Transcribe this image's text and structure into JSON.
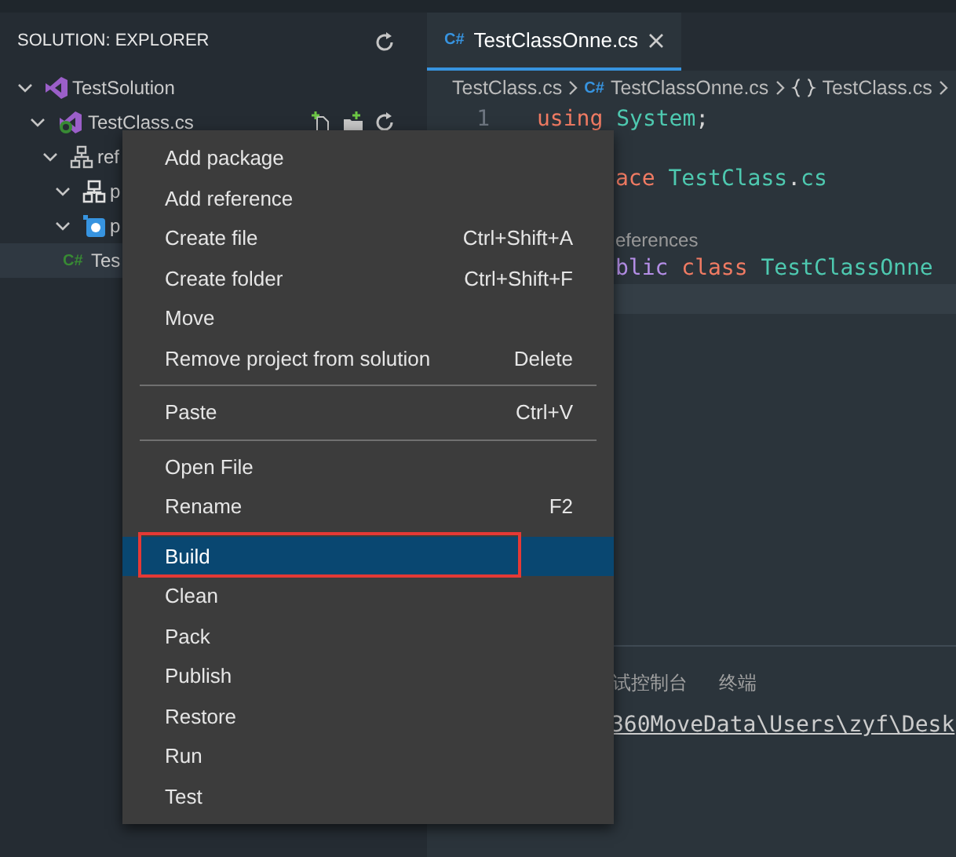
{
  "sidebar": {
    "title": "SOLUTION: EXPLORER",
    "tree": [
      {
        "label": "TestSolution",
        "kind": "solution",
        "expanded": true,
        "selected": false,
        "children": [
          {
            "label": "TestClass.cs",
            "kind": "project",
            "expanded": true,
            "selected": false,
            "actions": true,
            "children": [
              {
                "label": "ref",
                "kind": "references",
                "expanded": true,
                "selected": false,
                "children": [
                  {
                    "label": "p",
                    "kind": "packages",
                    "expanded": true,
                    "selected": false
                  },
                  {
                    "label": "p",
                    "kind": "project-ref",
                    "expanded": true,
                    "selected": false
                  }
                ]
              },
              {
                "label": "Tes",
                "kind": "file",
                "badge": "C#",
                "selected": true
              }
            ]
          }
        ]
      }
    ]
  },
  "editor": {
    "tabs": [
      {
        "label": "TestClassOnne.cs",
        "badge": "C#",
        "selected": true
      }
    ],
    "breadcrumb": [
      {
        "label": "TestClass.cs",
        "kind": "folder"
      },
      {
        "label": "TestClassOnne.cs",
        "kind": "file",
        "badge": "C#"
      },
      {
        "label": "TestClass.cs",
        "kind": "namespace"
      }
    ],
    "lines": [
      {
        "kind": "code",
        "number": "1",
        "tokens": [
          {
            "text": "using",
            "kind": "keyword"
          },
          {
            "text": " System",
            "kind": "type"
          },
          {
            "text": ";",
            "kind": "plain"
          }
        ]
      },
      {
        "kind": "blank"
      },
      {
        "kind": "code",
        "tokens": [
          {
            "text": "ace",
            "kind": "keyword"
          },
          {
            "text": " TestClass",
            "kind": "type"
          },
          {
            "text": ".",
            "kind": "plain"
          },
          {
            "text": "cs",
            "kind": "type"
          }
        ]
      },
      {
        "kind": "blank"
      },
      {
        "kind": "codelens",
        "text": "eferences"
      },
      {
        "kind": "code",
        "tokens": [
          {
            "text": "blic",
            "kind": "modifier"
          },
          {
            "text": " class",
            "kind": "keyword"
          },
          {
            "text": " TestClassOnne",
            "kind": "type"
          }
        ]
      },
      {
        "kind": "current"
      }
    ]
  },
  "panel": {
    "tabs": [
      {
        "label": "试控制台",
        "selected": false
      },
      {
        "label": "终端",
        "selected": false
      }
    ],
    "terminal": "360MoveData\\Users\\zyf\\Desk"
  },
  "context_menu": {
    "groups": [
      [
        {
          "label": "Add package",
          "selected": false
        },
        {
          "label": "Add reference",
          "selected": false
        },
        {
          "label": "Create file",
          "shortcut": "Ctrl+Shift+A",
          "selected": false
        },
        {
          "label": "Create folder",
          "shortcut": "Ctrl+Shift+F",
          "selected": false
        },
        {
          "label": "Move",
          "selected": false
        },
        {
          "label": "Remove project from solution",
          "shortcut": "Delete",
          "selected": false
        }
      ],
      [
        {
          "label": "Paste",
          "shortcut": "Ctrl+V",
          "selected": false
        }
      ],
      [
        {
          "label": "Open File",
          "selected": false
        },
        {
          "label": "Rename",
          "shortcut": "F2",
          "selected": false
        },
        {
          "label": "Build",
          "selected": true,
          "outlined": true
        },
        {
          "label": "Clean",
          "selected": false
        },
        {
          "label": "Pack",
          "selected": false
        },
        {
          "label": "Publish",
          "selected": false
        },
        {
          "label": "Restore",
          "selected": false
        },
        {
          "label": "Run",
          "selected": false
        },
        {
          "label": "Test",
          "selected": false
        }
      ]
    ]
  }
}
